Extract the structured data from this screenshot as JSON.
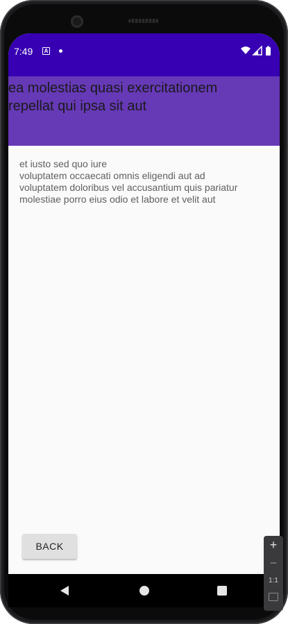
{
  "status_bar": {
    "time": "7:49",
    "notification_icon": "a-badge-icon",
    "wifi_icon": "wifi-icon",
    "signal_icon": "cell-signal-icon",
    "battery_icon": "battery-icon"
  },
  "app_bar": {
    "title_line1": "ea molestias quasi exercitationem",
    "title_line2": "repellat qui ipsa sit aut",
    "color": "#6639b7"
  },
  "content": {
    "lines": [
      "et iusto sed quo iure",
      "voluptatem occaecati omnis eligendi aut ad",
      "voluptatem doloribus vel accusantium quis pariatur",
      "molestiae porro eius odio et labore et velit aut"
    ]
  },
  "back_button": {
    "label": "BACK"
  },
  "zoom_controls": {
    "plus": "+",
    "minus": "−",
    "ratio": "1:1"
  },
  "colors": {
    "status_bar": "#3700b3",
    "app_bar": "#6639b7",
    "background": "#fafafa"
  }
}
